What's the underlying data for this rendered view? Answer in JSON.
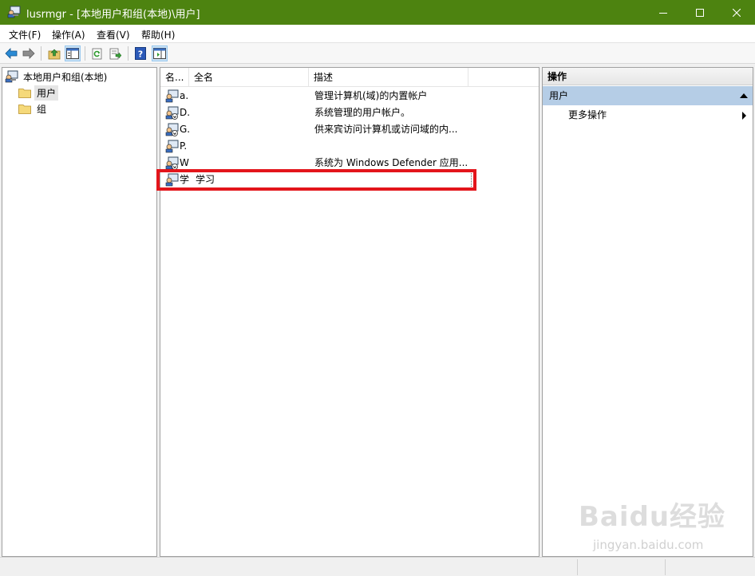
{
  "window": {
    "title": "lusrmgr - [本地用户和组(本地)\\用户]"
  },
  "menu": [
    "文件(F)",
    "操作(A)",
    "查看(V)",
    "帮助(H)"
  ],
  "toolbar": {
    "buttons": [
      "back-icon",
      "forward-icon",
      "up-folder-icon",
      "show-hide-tree-icon",
      "refresh-icon",
      "export-list-icon",
      "help-icon",
      "show-hide-action-pane-icon"
    ]
  },
  "tree": {
    "root": "本地用户和组(本地)",
    "children": [
      "用户",
      "组"
    ],
    "selected": "用户"
  },
  "list": {
    "columns": [
      "名...",
      "全名",
      "描述"
    ],
    "rows": [
      {
        "name": "a.",
        "fullname": "",
        "description": "管理计算机(域)的内置帐户"
      },
      {
        "name": "D.",
        "fullname": "",
        "description": "系统管理的用户帐户。"
      },
      {
        "name": "G.",
        "fullname": "",
        "description": "供来宾访问计算机或访问域的内..."
      },
      {
        "name": "P.",
        "fullname": "",
        "description": ""
      },
      {
        "name": "W",
        "fullname": "",
        "description": "系统为 Windows Defender 应用..."
      },
      {
        "name": "学",
        "fullname": "学习",
        "description": ""
      }
    ]
  },
  "actions": {
    "header": "操作",
    "section": "用户",
    "items": [
      "更多操作"
    ]
  },
  "watermark": {
    "logo": "Baidu经验",
    "url": "jingyan.baidu.com"
  },
  "colors": {
    "titlebar": "#4d8310",
    "highlight": "#e3151b",
    "action_section": "#b5cde6"
  }
}
